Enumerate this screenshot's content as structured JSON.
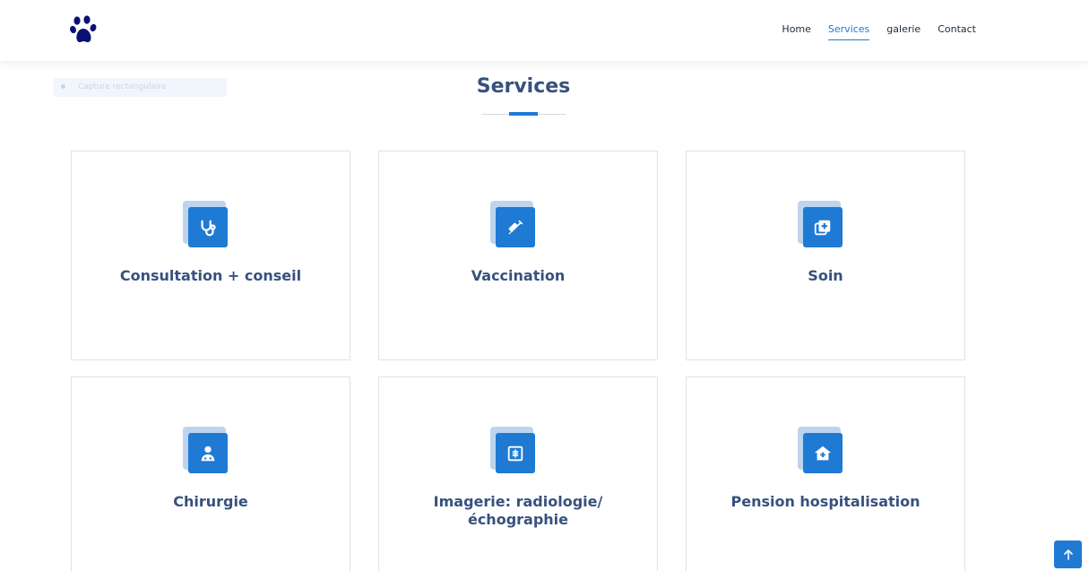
{
  "header": {
    "logo_icon": "paw-icon",
    "nav": [
      {
        "label": "Home",
        "active": false
      },
      {
        "label": "Services",
        "active": true
      },
      {
        "label": "galerie",
        "active": false
      },
      {
        "label": "Contact",
        "active": false
      }
    ]
  },
  "overlay": {
    "label": "Capture rectangulaire"
  },
  "section": {
    "title": "Services"
  },
  "services": [
    {
      "title": "Consultation + conseil",
      "icon": "stethoscope-icon"
    },
    {
      "title": "Vaccination",
      "icon": "syringe-icon"
    },
    {
      "title": "Soin",
      "icon": "medical-plus-icon"
    },
    {
      "title": "Chirurgie",
      "icon": "doctor-icon"
    },
    {
      "title": "Imagerie: radiologie/ échographie",
      "icon": "xray-icon"
    },
    {
      "title": "Pension hospitalisation",
      "icon": "hospital-house-icon"
    }
  ],
  "back_to_top": {
    "icon": "arrow-up-icon"
  },
  "colors": {
    "accent": "#1f7ad4",
    "heading": "#37517e",
    "icon_back": "#bdd4ee",
    "logo": "#0a1172"
  }
}
